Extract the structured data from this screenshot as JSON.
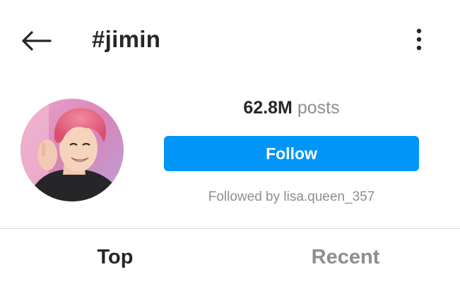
{
  "header": {
    "back_icon": "arrow-left-icon",
    "title": "#jimin",
    "more_icon": "vertical-dots-icon"
  },
  "profile": {
    "post_count": "62.8M",
    "post_unit": "posts",
    "follow_label": "Follow",
    "followed_by": "Followed by lisa.queen_357"
  },
  "tabs": [
    {
      "label": "Top",
      "active": true
    },
    {
      "label": "Recent",
      "active": false
    }
  ],
  "colors": {
    "accent": "#0095f6",
    "text_primary": "#262626",
    "text_secondary": "#8e8e8e",
    "divider": "#dbdbdb"
  }
}
